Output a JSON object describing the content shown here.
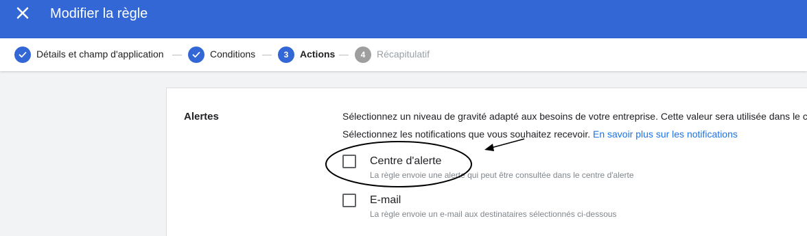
{
  "header": {
    "title": "Modifier la règle",
    "close_icon": "close-icon"
  },
  "stepper": {
    "steps": [
      {
        "label": "Détails et champ d'application",
        "status": "done",
        "marker": "✓"
      },
      {
        "label": "Conditions",
        "status": "done",
        "marker": "✓"
      },
      {
        "label": "Actions",
        "status": "active",
        "marker": "3"
      },
      {
        "label": "Récapitulatif",
        "status": "pending",
        "marker": "4"
      }
    ]
  },
  "alerts": {
    "title": "Alertes",
    "severity_text": "Sélectionnez un niveau de gravité adapté aux besoins de votre entreprise. Cette valeur sera utilisée dans le ce",
    "notifications_text": "Sélectionnez les notifications que vous souhaitez recevoir.",
    "learn_more_link": "En savoir plus sur les notifications",
    "options": [
      {
        "label": "Centre d'alerte",
        "help": "La règle envoie une alerte qui peut être consultée dans le centre d'alerte",
        "checked": false
      },
      {
        "label": "E-mail",
        "help": "La règle envoie un e-mail aux destinataires sélectionnés ci-dessous",
        "checked": false
      }
    ]
  },
  "colors": {
    "header_bg": "#3367d6",
    "step_active": "#3367d6",
    "step_pending": "#9e9e9e",
    "link": "#1a73e8"
  }
}
